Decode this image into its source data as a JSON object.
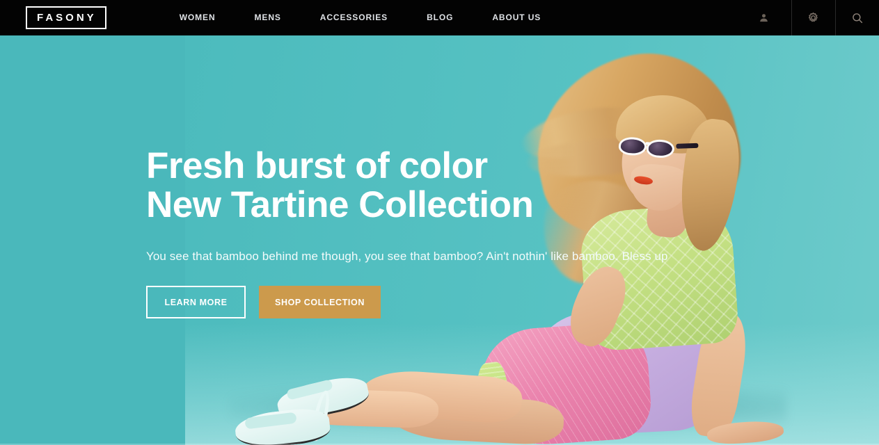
{
  "header": {
    "logo": {
      "text": "FASONY",
      "name": "brand-logo"
    },
    "nav_items": [
      {
        "label": "WOMEN"
      },
      {
        "label": "MENS"
      },
      {
        "label": "ACCESSORIES"
      },
      {
        "label": "BLOG"
      },
      {
        "label": "ABOUT US"
      }
    ],
    "actions": [
      {
        "icon": "user-account-icon",
        "label": "Account"
      },
      {
        "icon": "gear-icon",
        "label": "Settings"
      },
      {
        "icon": "search-icon",
        "label": "Search"
      }
    ]
  },
  "hero": {
    "title_line1": "Fresh burst of color",
    "title_line2": "New Tartine Collection",
    "subtitle": "You see that bamboo behind me though, you see that bamboo? Ain't nothin' like bamboo. Bless up",
    "primary_button": "SHOP COLLECTION",
    "secondary_button": "LEARN MORE",
    "image_alt": "Fashion model in green top, pink and lilac skirt and mint sandals seated on teal background"
  },
  "colors": {
    "header_background": "#030303",
    "hero_background": "#4ab8bb",
    "accent_gold": "#cc9a4c",
    "text_light": "#ffffff",
    "nav_text": "#dfe2e6"
  }
}
